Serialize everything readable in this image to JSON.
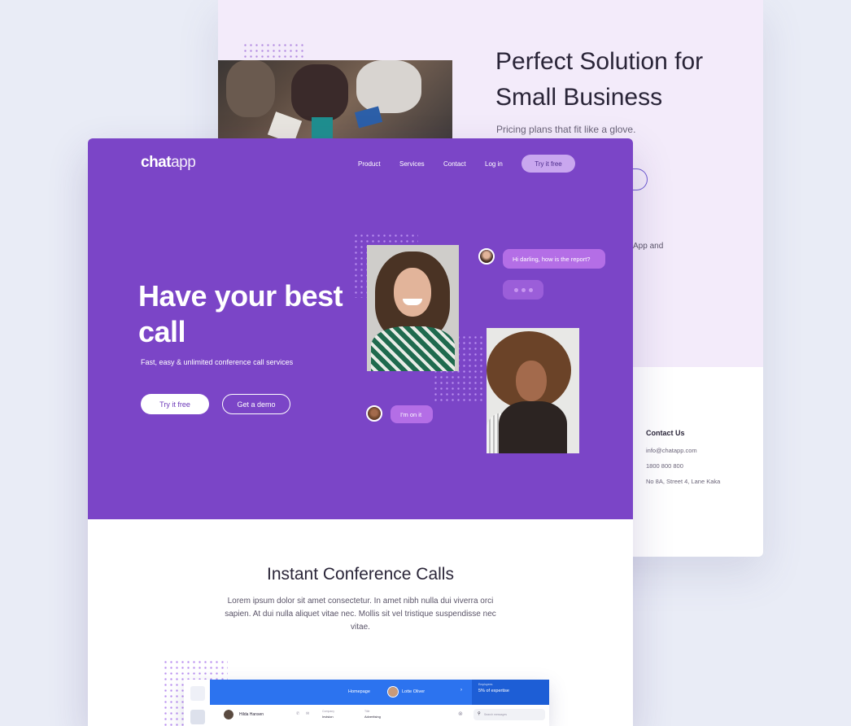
{
  "back": {
    "title": "Perfect Solution for Small Business",
    "subtitle": "Pricing plans that fit like a glove.",
    "text_fragment": "App and",
    "contact_title": "Contact Us",
    "contact_email": "info@chatapp.com",
    "contact_phone": "1800 800 800",
    "contact_address": "No 8A, Street 4, Lane Kaka"
  },
  "nav": {
    "logo_light": "chat",
    "logo_bold": "app",
    "items": [
      "Product",
      "Services",
      "Contact",
      "Log in"
    ],
    "cta": "Try it free"
  },
  "hero": {
    "title": "Have your best call",
    "subtitle": "Fast, easy & unlimited conference call services",
    "primary_button": "Try it free",
    "secondary_button": "Get a demo",
    "bubble_1": "Hi darling, how is the report?",
    "bubble_2": "I'm on it"
  },
  "content": {
    "title": "Instant Conference Calls",
    "text": "Lorem ipsum dolor sit amet consectetur. In amet nibh nulla dui viverra orci sapien. At dui nulla aliquet vitae nec. Mollis sit vel tristique suspendisse nec vitae."
  },
  "dashboard": {
    "nav_homepage": "Homepage",
    "user": "Lotte Oliver",
    "metric_label": "Employees",
    "metric_value": "5% of expertise",
    "row_name": "Hilda Hansen",
    "col1_label": "Company",
    "col1_value": "Invision",
    "col2_label": "Title",
    "col2_value": "Advertising",
    "search_placeholder": "Search messages"
  },
  "colors": {
    "hero_bg": "#7b45c7",
    "accent_light": "#c9a7ef",
    "bubble": "#b46ee6",
    "dashboard_blue": "#2c73ef"
  }
}
